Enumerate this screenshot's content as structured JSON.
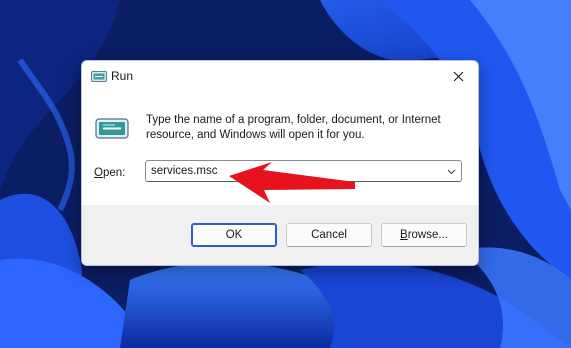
{
  "window": {
    "title": "Run",
    "icon": "run-app-icon",
    "close_icon": "close-icon"
  },
  "dialog": {
    "description": "Type the name of a program, folder, document, or Internet resource, and Windows will open it for you.",
    "open_label_mnemonic": "O",
    "open_label_rest": "pen:",
    "open_value": "services.msc"
  },
  "buttons": {
    "ok": "OK",
    "cancel": "Cancel",
    "browse_mnemonic": "B",
    "browse_rest": "rowse..."
  },
  "colors": {
    "annotation_arrow": "#e8121f",
    "default_button_border": "#2d5fbf",
    "wallpaper_blue": "#1e4fe0"
  }
}
